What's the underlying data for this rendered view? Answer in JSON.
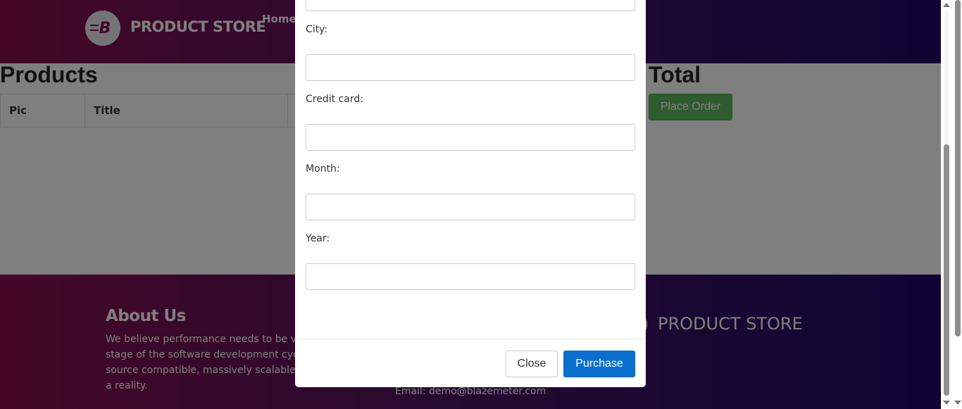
{
  "header": {
    "brand": "PRODUCT STORE",
    "nav": {
      "home": "Home"
    }
  },
  "main": {
    "products_title": "Products",
    "table_headers": [
      "Pic",
      "Title"
    ],
    "total_title": "Total",
    "place_order_label": "Place Order"
  },
  "footer": {
    "about_title": "About Us",
    "about_lines": [
      "We believe performance needs to be valid",
      "stage of the software development cycle a",
      "source compatible, massively scalable plat",
      "a reality."
    ],
    "email": "Email: demo@blazemeter.com",
    "brand": "PRODUCT STORE"
  },
  "modal": {
    "fields": [
      {
        "label": "City:",
        "value": ""
      },
      {
        "label": "Credit card:",
        "value": ""
      },
      {
        "label": "Month:",
        "value": ""
      },
      {
        "label": "Year:",
        "value": ""
      }
    ],
    "close_label": "Close",
    "purchase_label": "Purchase"
  },
  "colors": {
    "header_gradient_start": "#8a0f4f",
    "header_gradient_end": "#1c0a6a",
    "place_order_green": "#5cb85c",
    "purchase_blue": "#0b6fd0"
  }
}
